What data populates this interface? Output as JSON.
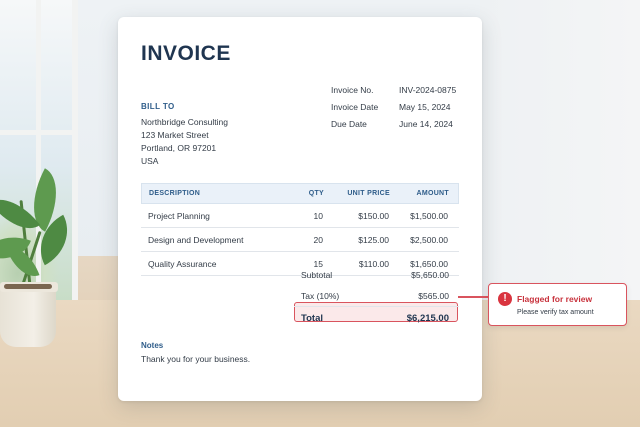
{
  "invoice": {
    "title": "INVOICE",
    "bill_to": {
      "label": "BILL TO",
      "lines": [
        "Northbridge Consulting",
        "123 Market Street",
        "Portland, OR 97201",
        "USA"
      ]
    },
    "meta": [
      {
        "label": "Invoice No.",
        "value": "INV-2024-0875"
      },
      {
        "label": "Invoice Date",
        "value": "May 15, 2024"
      },
      {
        "label": "Due Date",
        "value": "June 14, 2024"
      }
    ],
    "table": {
      "headers": {
        "description": "DESCRIPTION",
        "qty": "QTY",
        "unit_price": "UNIT PRICE",
        "amount": "AMOUNT"
      },
      "rows": [
        {
          "description": "Project Planning",
          "qty": "10",
          "unit_price": "$150.00",
          "amount": "$1,500.00"
        },
        {
          "description": "Design and Development",
          "qty": "20",
          "unit_price": "$125.00",
          "amount": "$2,500.00"
        },
        {
          "description": "Quality Assurance",
          "qty": "15",
          "unit_price": "$110.00",
          "amount": "$1,650.00"
        }
      ]
    },
    "summary": {
      "subtotal_label": "Subtotal",
      "subtotal_value": "$5,650.00",
      "tax_label": "Tax (10%)",
      "tax_value": "$565.00",
      "total_label": "Total",
      "total_value": "$6,215.00"
    },
    "notes": {
      "label": "Notes",
      "text": "Thank you for your business."
    }
  },
  "flag": {
    "icon": "alert-circle-icon",
    "icon_glyph": "!",
    "title": "Flagged for review",
    "message": "Please verify tax amount",
    "color": "#d9343f"
  },
  "colors": {
    "heading": "#1f3550",
    "accent": "#2f5d8a",
    "header_fill": "#eaf1f9",
    "flag_fill": "#fbe9ea"
  }
}
